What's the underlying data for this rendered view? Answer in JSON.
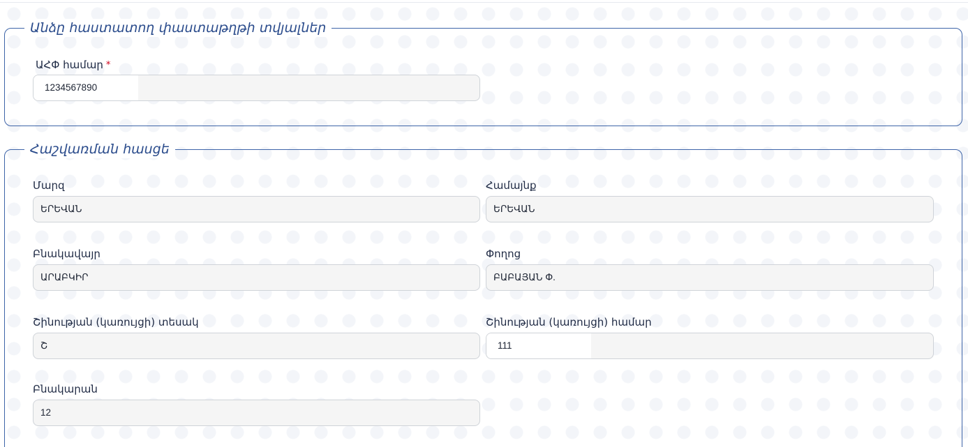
{
  "section1": {
    "legend": "Անձը հաստատող փաստաթղթի տվյալներ",
    "id_number": {
      "label": "ԱՀՓ համար",
      "required_mark": "*",
      "value": "1234567890"
    }
  },
  "section2": {
    "legend": "Հաշվառման հասցե",
    "region": {
      "label": "Մարզ",
      "value": "ԵՐԵՎԱՆ"
    },
    "community": {
      "label": "Համայնք",
      "value": "ԵՐԵՎԱՆ"
    },
    "settlement": {
      "label": "Բնակավայր",
      "value": "ԱՐԱԲԿԻՐ"
    },
    "street": {
      "label": "Փողոց",
      "value": "ԲԱԲԱՅԱՆ Փ."
    },
    "building_type": {
      "label": "Շինության (կառույցի) տեսակ",
      "value": "Շ"
    },
    "building_number": {
      "label": "Շինության (կառույցի) համար",
      "value": "111"
    },
    "apartment": {
      "label": "Բնակարան",
      "value": "12"
    }
  },
  "colors": {
    "border": "#3e64a8",
    "legend_text": "#2b4c8c",
    "required": "#d0021b",
    "input_bg": "#f5f5f5"
  }
}
